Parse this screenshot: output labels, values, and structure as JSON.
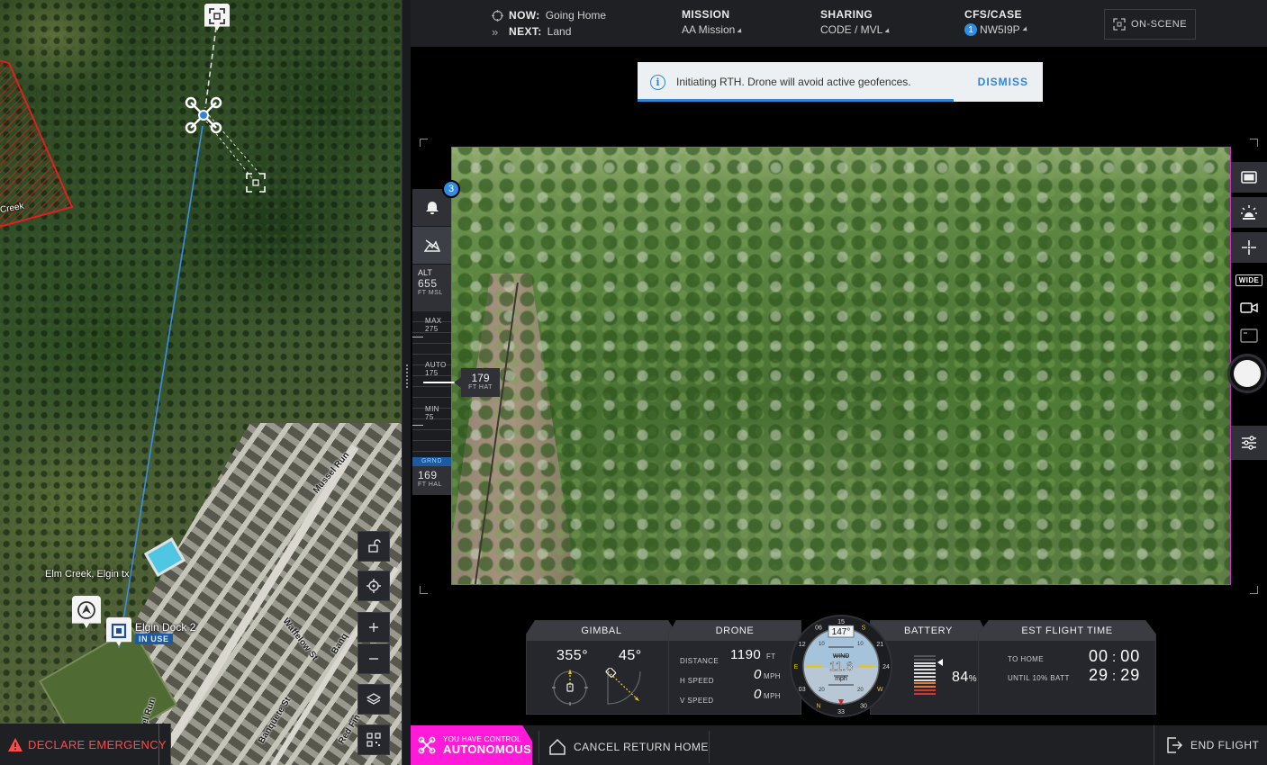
{
  "map": {
    "place_label": "Elm Creek, Elgin tx",
    "geofence_label": "Creek",
    "dock_label": "Elgin Dock 2",
    "dock_status": "IN USE",
    "streets": [
      "Mussel Run",
      "Waffelow St",
      "Banquete St",
      "Red Fin",
      "Banq",
      "el Run"
    ],
    "emergency_label": "DECLARE EMERGENCY",
    "colors": {
      "emergency": "#ff4a4a",
      "geofence": "#e02020",
      "flight_path": "#3a8ee6",
      "dock_status_bg": "#1e5aa0"
    },
    "buttons": [
      "lock-icon",
      "locate-icon",
      "zoom-in",
      "zoom-out",
      "layers-icon",
      "qr-icon"
    ]
  },
  "topbar": {
    "now_label": "NOW:",
    "now_value": "Going Home",
    "next_label": "NEXT:",
    "next_value": "Land",
    "mission_label": "MISSION",
    "mission_value": "AA Mission",
    "sharing_label": "SHARING",
    "sharing_value": "CODE / MVL",
    "cfs_label": "CFS/CASE",
    "cfs_badge": "1",
    "cfs_value": "NW5I9P",
    "onscene_label": "ON-SCENE"
  },
  "notice": {
    "message": "Initiating RTH. Drone will avoid active geofences.",
    "dismiss_label": "DISMISS",
    "progress_fraction": 0.78
  },
  "altitude": {
    "alerts_count": "3",
    "alt_label": "ALT",
    "alt_value": "655",
    "alt_unit": "FT MSL",
    "max_label": "MAX",
    "max_value": "275",
    "auto_label": "AUTO",
    "auto_value": "175",
    "min_label": "MIN",
    "min_value": "75",
    "grnd_label": "GRND",
    "hal_value": "169",
    "hal_unit": "FT HAL",
    "hat_value": "179",
    "hat_unit": "FT HAT"
  },
  "camera": {
    "wide_label": "WIDE"
  },
  "gimbal": {
    "title": "GIMBAL",
    "heading": "355°",
    "pitch": "45°"
  },
  "drone": {
    "title": "DRONE",
    "distance_label": "DISTANCE",
    "distance_value": "1190",
    "distance_unit": "FT",
    "hspeed_label": "H SPEED",
    "hspeed_value": "0",
    "hspeed_unit": "MPH",
    "vspeed_label": "V SPEED",
    "vspeed_value": "0",
    "vspeed_unit": "MPH"
  },
  "hud": {
    "heading": "147°",
    "wind_label": "WIND",
    "wind_value": "11.6",
    "wind_unit": "mph",
    "compass": [
      "15",
      "S",
      "21",
      "24",
      "W",
      "30",
      "33",
      "N",
      "03",
      "E",
      "12",
      "06"
    ],
    "pitch_marks": [
      "10",
      "10",
      "20",
      "20"
    ]
  },
  "battery": {
    "title": "BATTERY",
    "percent": "84",
    "percent_unit": "%",
    "level_fraction": 0.84
  },
  "flight_time": {
    "title": "EST FLIGHT TIME",
    "to_home_label": "TO HOME",
    "to_home_min": "00",
    "to_home_sec": "00",
    "until_label": "UNTIL 10% BATT",
    "until_min": "29",
    "until_sec": "29",
    "separator": ":"
  },
  "bottombar": {
    "control_small": "YOU HAVE CONTROL",
    "control_mode": "AUTONOMOUS",
    "cancel_label": "CANCEL RETURN HOME",
    "end_label": "END FLIGHT",
    "control_color": "#ff1ad9"
  }
}
